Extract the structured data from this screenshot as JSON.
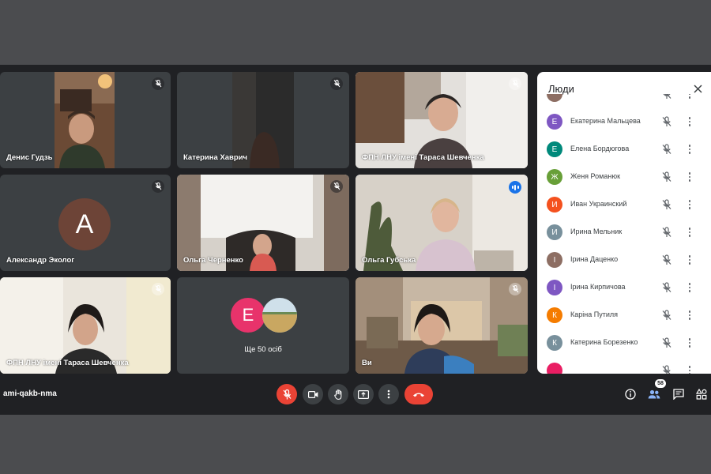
{
  "meeting": {
    "code": "ami-qakb-nma"
  },
  "tiles": {
    "t1": {
      "name": "Денис Гудзь"
    },
    "t2": {
      "name": "Катерина Хаврич"
    },
    "t3": {
      "name": "ФПН ЛНУ імені Тараса Шевченка"
    },
    "t4": {
      "name": "Александр Эколог",
      "avatar_letter": "A"
    },
    "t5": {
      "name": "Ольга Черненко"
    },
    "t6": {
      "name": "Ольга Губська"
    },
    "t7": {
      "name": "ФПН ЛНУ імені Тараса Шевченка"
    },
    "t8": {
      "more_label": "Ще 50 осіб",
      "avatar_letter": "E"
    },
    "t9": {
      "name": "Ви"
    }
  },
  "people_panel": {
    "title": "Люди",
    "people": [
      {
        "name": "",
        "letter": "",
        "color": "#8d6e63"
      },
      {
        "name": "Екатерина Мальцева",
        "letter": "Е",
        "color": "#7e57c2"
      },
      {
        "name": "Елена Бордюгова",
        "letter": "Е",
        "color": "#00897b"
      },
      {
        "name": "Женя Романюк",
        "letter": "Ж",
        "color": "#689f38"
      },
      {
        "name": "Иван Украинский",
        "letter": "И",
        "color": "#f4511e"
      },
      {
        "name": "Ирина Мельник",
        "letter": "И",
        "color": "#78909c"
      },
      {
        "name": "Ірина Даценко",
        "letter": "І",
        "color": "#8d6e63"
      },
      {
        "name": "Ірина Кирпичова",
        "letter": "І",
        "color": "#7e57c2"
      },
      {
        "name": "Каріна Путиля",
        "letter": "К",
        "color": "#f57c00"
      },
      {
        "name": "Катерина Борезенко",
        "letter": "К",
        "color": "#78909c"
      },
      {
        "name": "",
        "letter": "",
        "color": "#e91e63"
      }
    ]
  },
  "toolbar": {
    "participants_count": "58"
  },
  "colors": {
    "accent_blue": "#1a73e8",
    "end_call_red": "#ea4335",
    "app_bg": "#202124",
    "tile_bg": "#3c4043"
  }
}
